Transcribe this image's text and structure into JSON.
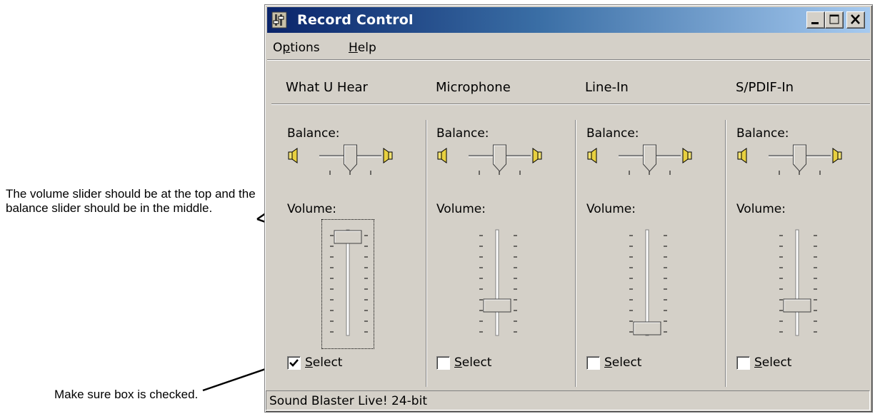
{
  "window": {
    "title": "Record Control"
  },
  "menu": {
    "options_pre": "O",
    "options_u": "p",
    "options_post": "tions",
    "help_u": "H",
    "help_post": "elp"
  },
  "columns": [
    {
      "name": "What U Hear",
      "balance_label": "Balance:",
      "volume_label": "Volume:",
      "balance": 0.5,
      "volume": 1.0,
      "selected": true,
      "select_u": "S",
      "select_post": "elect"
    },
    {
      "name": "Microphone",
      "balance_label": "Balance:",
      "volume_label": "Volume:",
      "balance": 0.5,
      "volume": 0.25,
      "selected": false,
      "select_u": "S",
      "select_post": "elect"
    },
    {
      "name": "Line-In",
      "balance_label": "Balance:",
      "volume_label": "Volume:",
      "balance": 0.5,
      "volume": 0.0,
      "selected": false,
      "select_u": "S",
      "select_post": "elect"
    },
    {
      "name": "S/PDIF-In",
      "balance_label": "Balance:",
      "volume_label": "Volume:",
      "balance": 0.5,
      "volume": 0.25,
      "selected": false,
      "select_u": "S",
      "select_post": "elect"
    }
  ],
  "status": {
    "text": "Sound Blaster Live! 24-bit"
  },
  "annotations": {
    "slider_note": "The volume slider should be at the top and the balance slider should be in the middle.",
    "checkbox_note": "Make sure box is checked."
  },
  "icons": {
    "app": "mixer-icon",
    "speaker_left": "speaker-left-icon",
    "speaker_right": "speaker-right-icon"
  }
}
